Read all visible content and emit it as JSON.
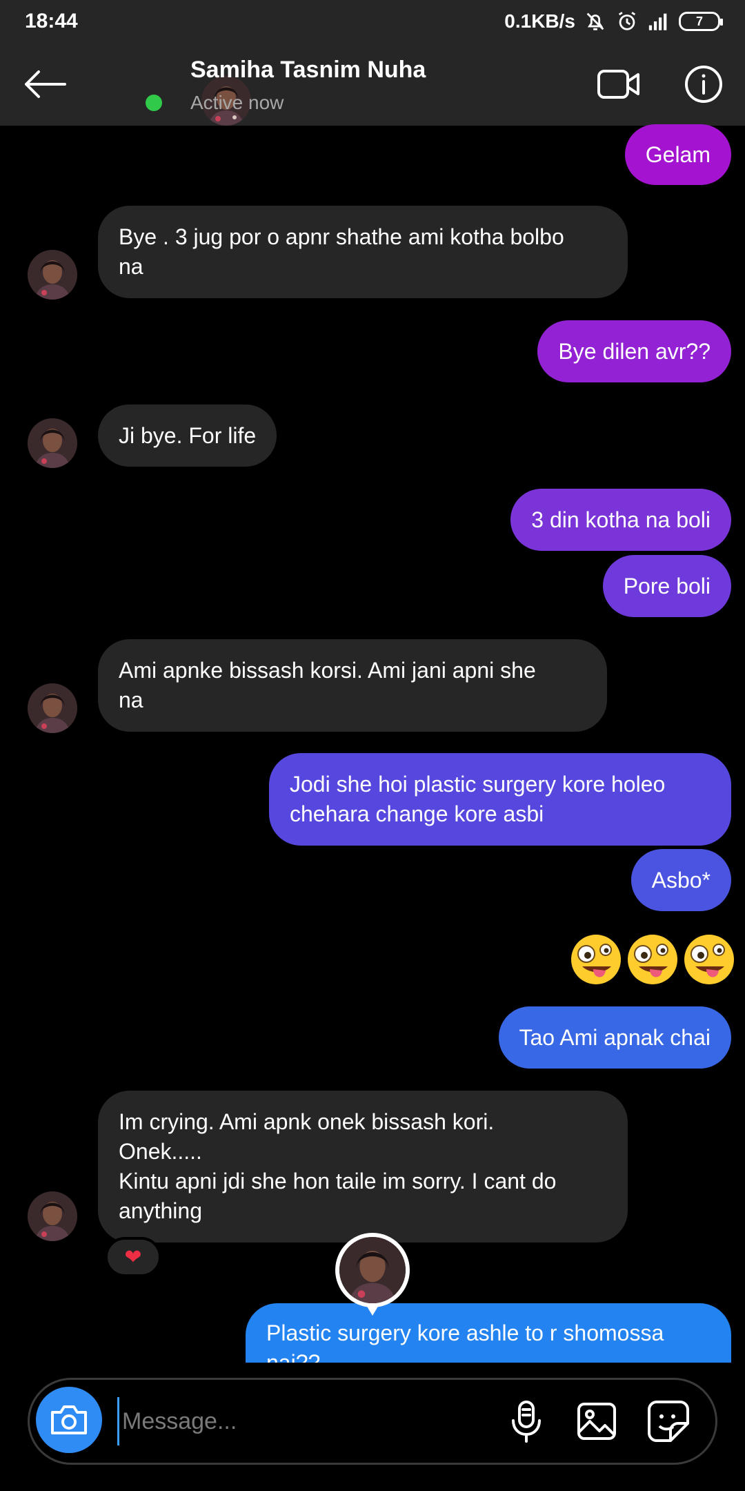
{
  "status_bar": {
    "time": "18:44",
    "network_speed": "0.1KB/s",
    "battery": "7",
    "icons": [
      "mute-bell-icon",
      "alarm-icon",
      "signal-icon",
      "battery-icon"
    ]
  },
  "header": {
    "contact_name": "Samiha Tasnim Nuha",
    "status": "Active now",
    "icons": [
      "back-arrow-icon",
      "video-call-icon",
      "info-icon"
    ]
  },
  "messages": [
    {
      "from": "me",
      "text": "Gelam"
    },
    {
      "from": "them",
      "text": "Bye . 3 jug por o apnr shathe ami kotha bolbo\nna"
    },
    {
      "from": "me",
      "text": "Bye dilen avr??"
    },
    {
      "from": "them",
      "text": "Ji bye. For life"
    },
    {
      "from": "me",
      "text": "3 din kotha na boli"
    },
    {
      "from": "me",
      "text": "Pore boli"
    },
    {
      "from": "them",
      "text": "Ami apnke bissash korsi. Ami jani apni she\nna"
    },
    {
      "from": "me",
      "text": "Jodi she hoi plastic surgery kore holeo\nchehara change kore asbi"
    },
    {
      "from": "me",
      "text": "Asbo*"
    },
    {
      "from": "me",
      "emoji": "🤪🤪🤪"
    },
    {
      "from": "me",
      "text": "Tao Ami apnak chai"
    },
    {
      "from": "them",
      "text": "Im crying. Ami apnk onek bissash kori.\nOnek.....\nKintu apni jdi she hon taile im sorry. I cant do\nanything"
    },
    {
      "from": "me",
      "text": "Plastic surgery kore ashle to r shomossa\nnai??"
    }
  ],
  "reaction": "❤",
  "colors": {
    "bar_bg": "#262626",
    "incoming_bubble": "#262626",
    "gradient": [
      "#a414d0",
      "#8a2ed8",
      "#6a3fdc",
      "#4f56e0",
      "#366de6",
      "#2383f0"
    ],
    "online": "#31c94a",
    "camera_button": "#2f8cf5"
  },
  "composer": {
    "placeholder": "Message...",
    "icons": [
      "camera-icon",
      "microphone-icon",
      "gallery-icon",
      "sticker-icon"
    ]
  }
}
